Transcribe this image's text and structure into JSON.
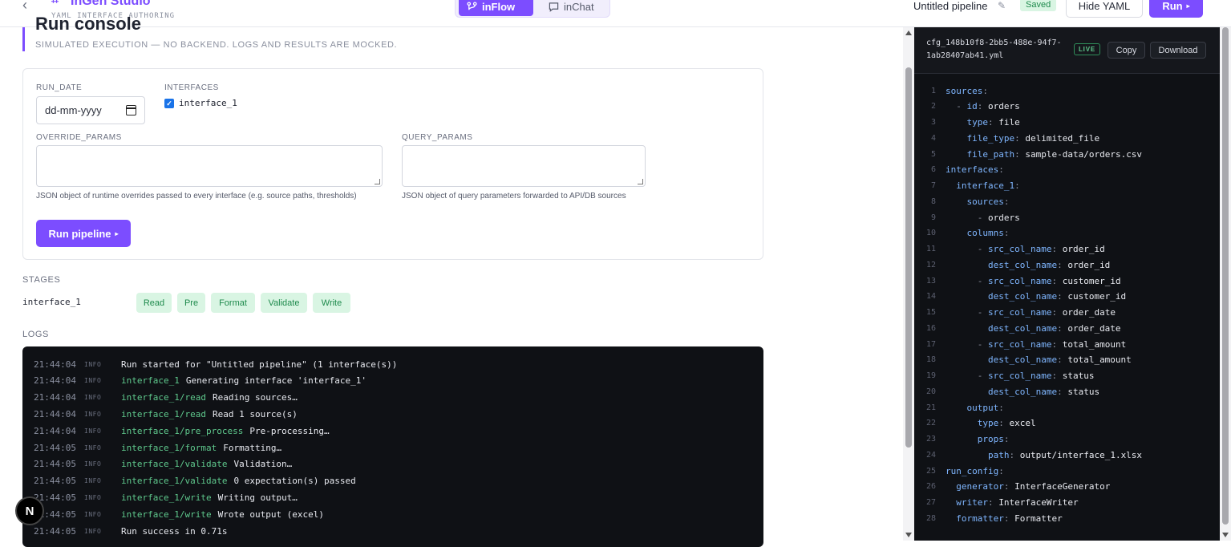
{
  "header": {
    "brand_name": "InGen Studio",
    "brand_sub": "YAML INTERFACE AUTHORING",
    "mode_inflow": "inFlow",
    "mode_inchat": "inChat",
    "pipeline_title": "Untitled pipeline",
    "saved_badge": "Saved",
    "hide_yaml": "Hide YAML",
    "run": "Run"
  },
  "page": {
    "heading": "Run console",
    "subheading": "SIMULATED EXECUTION — NO BACKEND. LOGS AND RESULTS ARE MOCKED."
  },
  "form": {
    "run_date_label": "RUN_DATE",
    "run_date_placeholder": "dd-mm-yyyy",
    "interfaces_label": "INTERFACES",
    "interface_option": "interface_1",
    "interface_checked": true,
    "override_label": "OVERRIDE_PARAMS",
    "override_help": "JSON object of runtime overrides passed to every interface (e.g. source paths, thresholds)",
    "query_label": "QUERY_PARAMS",
    "query_help": "JSON object of query parameters forwarded to API/DB sources",
    "run_button": "Run pipeline"
  },
  "stages": {
    "label": "STAGES",
    "interface": "interface_1",
    "pills": [
      "Read",
      "Pre",
      "Format",
      "Validate",
      "Write"
    ]
  },
  "logs": {
    "label": "LOGS",
    "lines": [
      {
        "time": "21:44:04",
        "level": "INFO",
        "scope": "",
        "msg": "Run started for \"Untitled pipeline\" (1 interface(s))"
      },
      {
        "time": "21:44:04",
        "level": "INFO",
        "scope": "interface_1",
        "msg": "Generating interface 'interface_1'"
      },
      {
        "time": "21:44:04",
        "level": "INFO",
        "scope": "interface_1/read",
        "msg": "Reading sources…"
      },
      {
        "time": "21:44:04",
        "level": "INFO",
        "scope": "interface_1/read",
        "msg": "Read 1 source(s)"
      },
      {
        "time": "21:44:04",
        "level": "INFO",
        "scope": "interface_1/pre_process",
        "msg": "Pre-processing…"
      },
      {
        "time": "21:44:05",
        "level": "INFO",
        "scope": "interface_1/format",
        "msg": "Formatting…"
      },
      {
        "time": "21:44:05",
        "level": "INFO",
        "scope": "interface_1/validate",
        "msg": "Validation…"
      },
      {
        "time": "21:44:05",
        "level": "INFO",
        "scope": "interface_1/validate",
        "msg": "0 expectation(s) passed"
      },
      {
        "time": "21:44:05",
        "level": "INFO",
        "scope": "interface_1/write",
        "msg": "Writing output…"
      },
      {
        "time": "21:44:05",
        "level": "INFO",
        "scope": "interface_1/write",
        "msg": "Wrote output (excel)"
      },
      {
        "time": "21:44:05",
        "level": "INFO",
        "scope": "",
        "msg": "Run success in 0.71s"
      }
    ]
  },
  "yaml": {
    "filename": "cfg_148b10f8-2bb5-488e-94f7-1ab28407ab41.yml",
    "live": "LIVE",
    "copy": "Copy",
    "download": "Download",
    "lines": [
      {
        "n": "1",
        "indent": "",
        "dash": "",
        "key": "sources",
        "val": ""
      },
      {
        "n": "2",
        "indent": "  ",
        "dash": "- ",
        "key": "id",
        "val": "orders"
      },
      {
        "n": "3",
        "indent": "    ",
        "dash": "",
        "key": "type",
        "val": "file"
      },
      {
        "n": "4",
        "indent": "    ",
        "dash": "",
        "key": "file_type",
        "val": "delimited_file"
      },
      {
        "n": "5",
        "indent": "    ",
        "dash": "",
        "key": "file_path",
        "val": "sample-data/orders.csv"
      },
      {
        "n": "6",
        "indent": "",
        "dash": "",
        "key": "interfaces",
        "val": ""
      },
      {
        "n": "7",
        "indent": "  ",
        "dash": "",
        "key": "interface_1",
        "val": ""
      },
      {
        "n": "8",
        "indent": "    ",
        "dash": "",
        "key": "sources",
        "val": ""
      },
      {
        "n": "9",
        "indent": "      ",
        "dash": "- ",
        "key": "",
        "val": "orders"
      },
      {
        "n": "10",
        "indent": "    ",
        "dash": "",
        "key": "columns",
        "val": ""
      },
      {
        "n": "11",
        "indent": "      ",
        "dash": "- ",
        "key": "src_col_name",
        "val": "order_id"
      },
      {
        "n": "12",
        "indent": "        ",
        "dash": "",
        "key": "dest_col_name",
        "val": "order_id"
      },
      {
        "n": "13",
        "indent": "      ",
        "dash": "- ",
        "key": "src_col_name",
        "val": "customer_id"
      },
      {
        "n": "14",
        "indent": "        ",
        "dash": "",
        "key": "dest_col_name",
        "val": "customer_id"
      },
      {
        "n": "15",
        "indent": "      ",
        "dash": "- ",
        "key": "src_col_name",
        "val": "order_date"
      },
      {
        "n": "16",
        "indent": "        ",
        "dash": "",
        "key": "dest_col_name",
        "val": "order_date"
      },
      {
        "n": "17",
        "indent": "      ",
        "dash": "- ",
        "key": "src_col_name",
        "val": "total_amount"
      },
      {
        "n": "18",
        "indent": "        ",
        "dash": "",
        "key": "dest_col_name",
        "val": "total_amount"
      },
      {
        "n": "19",
        "indent": "      ",
        "dash": "- ",
        "key": "src_col_name",
        "val": "status"
      },
      {
        "n": "20",
        "indent": "        ",
        "dash": "",
        "key": "dest_col_name",
        "val": "status"
      },
      {
        "n": "21",
        "indent": "    ",
        "dash": "",
        "key": "output",
        "val": ""
      },
      {
        "n": "22",
        "indent": "      ",
        "dash": "",
        "key": "type",
        "val": "excel"
      },
      {
        "n": "23",
        "indent": "      ",
        "dash": "",
        "key": "props",
        "val": ""
      },
      {
        "n": "24",
        "indent": "        ",
        "dash": "",
        "key": "path",
        "val": "output/interface_1.xlsx"
      },
      {
        "n": "25",
        "indent": "",
        "dash": "",
        "key": "run_config",
        "val": ""
      },
      {
        "n": "26",
        "indent": "  ",
        "dash": "",
        "key": "generator",
        "val": "InterfaceGenerator"
      },
      {
        "n": "27",
        "indent": "  ",
        "dash": "",
        "key": "writer",
        "val": "InterfaceWriter"
      },
      {
        "n": "28",
        "indent": "  ",
        "dash": "",
        "key": "formatter",
        "val": "Formatter"
      }
    ]
  },
  "misc": {
    "next_badge": "N"
  }
}
